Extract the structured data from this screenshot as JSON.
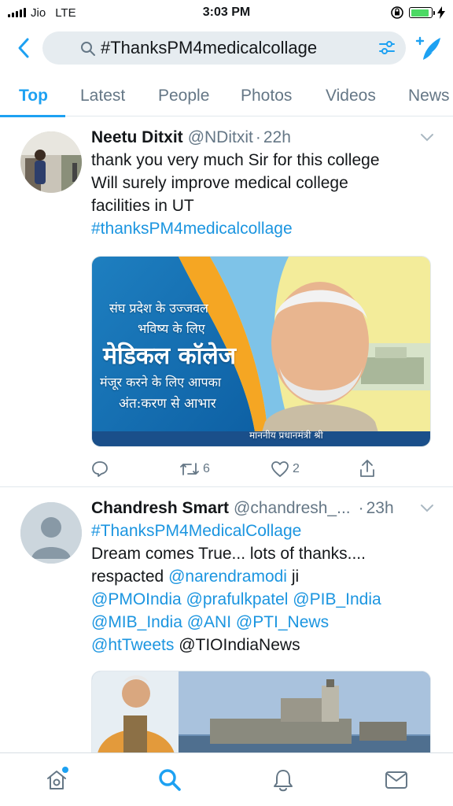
{
  "status_bar": {
    "carrier": "Jio",
    "network": "LTE",
    "time": "3:03 PM"
  },
  "search": {
    "query": "#ThanksPM4medicalcollage"
  },
  "tabs": [
    {
      "label": "Top",
      "active": true
    },
    {
      "label": "Latest",
      "active": false
    },
    {
      "label": "People",
      "active": false
    },
    {
      "label": "Photos",
      "active": false
    },
    {
      "label": "Videos",
      "active": false
    },
    {
      "label": "News",
      "active": false
    }
  ],
  "tweets": [
    {
      "name": "Neetu Ditxit",
      "handle": "@NDitxit",
      "time": "22h",
      "text_line1": "thank you very much Sir for this college",
      "text_line2": "Will surely improve medical college",
      "text_line3": "facilities in UT",
      "hashtag": "#thanksPM4medicalcollage",
      "image_text": {
        "line1": "संघ प्रदेश के  उज्जवल",
        "line2": "भविष्य के लिए",
        "line3": "मेडिकल कॉलेज",
        "line4": "मंजूर करने के लिए आपका",
        "line5": "अंत:करण से आभार",
        "caption": "माननीय प्रधानमंत्री श्री"
      },
      "retweets": "6",
      "likes": "2"
    },
    {
      "name": "Chandresh Smart",
      "handle": "@chandresh_...",
      "time": "23h",
      "hashtag": "#ThanksPM4MedicalCollage",
      "text_line1": "Dream comes True... lots of thanks....",
      "text_line2_prefix": "respacted",
      "mention_modi": "@narendramodi",
      "text_line2_suffix": "ji",
      "mentions_line3": [
        "@PMOIndia",
        "@prafulkpatel",
        "@PIB_India"
      ],
      "mentions_line4": [
        "@MIB_India",
        "@ANI",
        "@PTI_News"
      ],
      "mention_httweets": "@htTweets",
      "plain_tail": "@TIOIndiaNews"
    }
  ],
  "colors": {
    "accent": "#1da1f2",
    "link": "#1b95e0",
    "muted": "#657786"
  }
}
